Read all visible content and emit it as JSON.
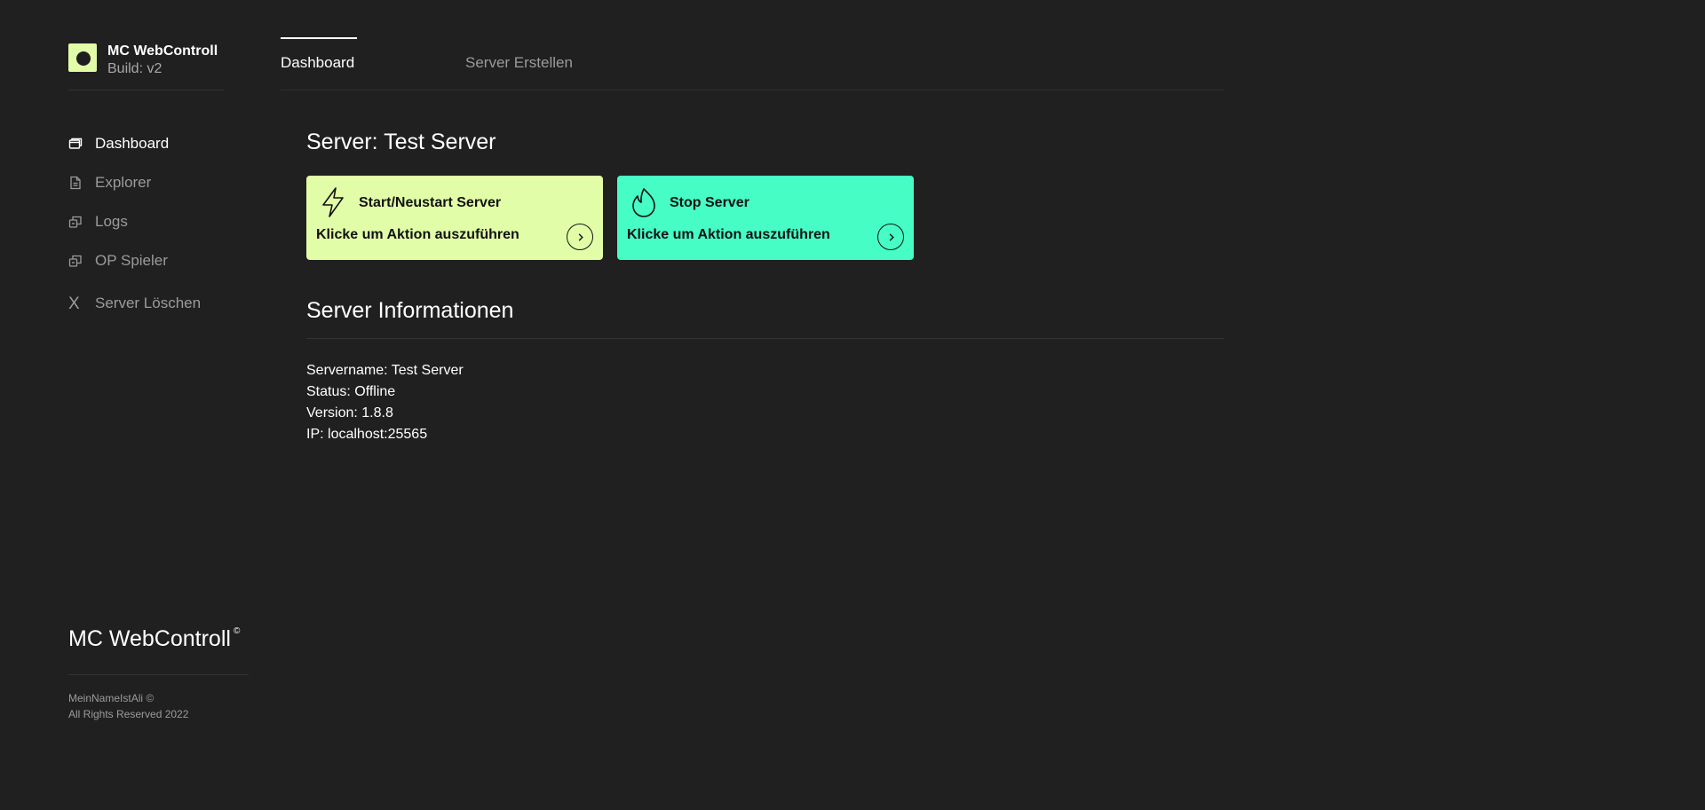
{
  "brand": {
    "name": "MC WebControll",
    "build": "Build: v2"
  },
  "sidebar": {
    "items": [
      {
        "label": "Dashboard",
        "icon": "window-icon",
        "active": true
      },
      {
        "label": "Explorer",
        "icon": "document-icon",
        "active": false
      },
      {
        "label": "Logs",
        "icon": "stack-icon",
        "active": false
      },
      {
        "label": "OP Spieler",
        "icon": "stack-icon",
        "active": false
      },
      {
        "label": "Server Löschen",
        "icon": "x-icon",
        "active": false
      }
    ],
    "x_glyph": "X"
  },
  "tabs": [
    {
      "label": "Dashboard",
      "active": true
    },
    {
      "label": "Server Erstellen",
      "active": false
    }
  ],
  "main": {
    "title": "Server: Test Server",
    "actions": [
      {
        "title": "Start/Neustart Server",
        "subtitle": "Klicke um Aktion auszuführen",
        "color": "#e2fda7",
        "icon": "lightning-icon"
      },
      {
        "title": "Stop Server",
        "subtitle": "Klicke um Aktion auszuführen",
        "color": "#45fdc5",
        "icon": "flame-icon"
      }
    ],
    "info_title": "Server Informationen",
    "info": [
      "Servername: Test Server",
      "Status: Offline",
      "Version: 1.8.8",
      "IP: localhost:25565"
    ]
  },
  "footer": {
    "brand": "MC WebControll",
    "copyright_mark": "©",
    "line1": "MeinNameIstAli ©",
    "line2": "All Rights Reserved 2022"
  },
  "colors": {
    "background": "#202020",
    "accent_lime": "#e2fda7",
    "accent_mint": "#45fdc5",
    "muted_text": "#9b9b9b"
  }
}
